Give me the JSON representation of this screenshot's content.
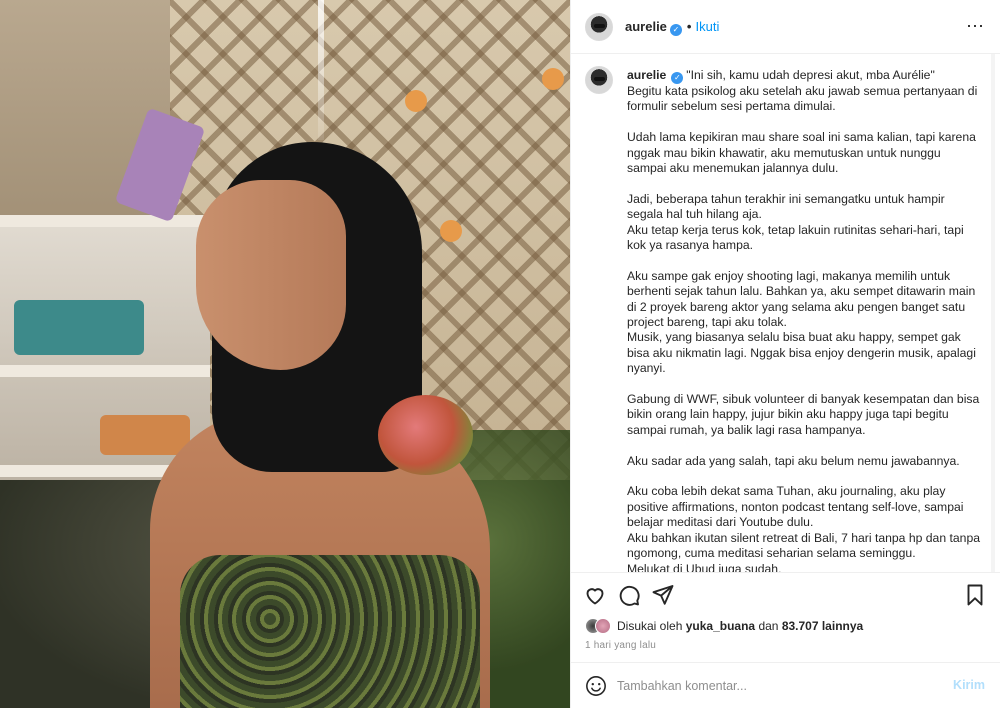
{
  "post": {
    "username": "aurelie",
    "follow_label": "Ikuti",
    "dot": "•",
    "more_icon": "⋯",
    "colors": {
      "link": "#0095f6",
      "verified": "#3897f0",
      "muted": "#8e8e8e"
    }
  },
  "caption": {
    "username": "aurelie",
    "paragraphs": [
      "\"Ini sih, kamu udah depresi akut, mba Aurélie\"\nBegitu kata psikolog aku setelah aku jawab semua pertanyaan di formulir sebelum sesi pertama dimulai.",
      "Udah lama kepikiran mau share soal ini sama kalian, tapi karena nggak mau bikin khawatir, aku memutuskan untuk nunggu sampai aku menemukan jalannya dulu.",
      "Jadi, beberapa tahun terakhir ini semangatku untuk hampir segala hal tuh hilang aja.\nAku tetap kerja terus kok, tetap lakuin rutinitas sehari-hari, tapi kok ya rasanya hampa.",
      "Aku sampe gak enjoy shooting lagi, makanya memilih untuk berhenti sejak tahun lalu. Bahkan ya, aku sempet ditawarin main di 2 proyek bareng aktor yang selama aku pengen banget satu project bareng, tapi aku tolak.\nMusik, yang biasanya selalu bisa buat aku happy, sempet gak bisa aku nikmatin lagi. Nggak bisa enjoy dengerin musik, apalagi nyanyi.",
      "Gabung di WWF, sibuk volunteer di banyak kesempatan dan bisa bikin orang lain happy, jujur bikin aku happy juga tapi begitu sampai rumah, ya balik lagi rasa hampanya.",
      "Aku sadar ada yang salah, tapi aku belum nemu jawabannya.",
      "Aku coba lebih dekat sama Tuhan, aku journaling, aku play positive affirmations, nonton podcast tentang self-love, sampai belajar meditasi dari Youtube dulu.\nAku bahkan ikutan silent retreat di Bali, 7 hari tanpa hp dan tanpa ngomong, cuma meditasi seharian selama seminggu.\nMelukat di Ubud juga sudah."
    ]
  },
  "likes": {
    "prefix": "Disukai oleh",
    "user": "yuka_buana",
    "middle": "dan",
    "count": "83.707 lainnya"
  },
  "timestamp": "1 hari yang lalu",
  "comment": {
    "placeholder": "Tambahkan komentar...",
    "send_label": "Kirim"
  }
}
